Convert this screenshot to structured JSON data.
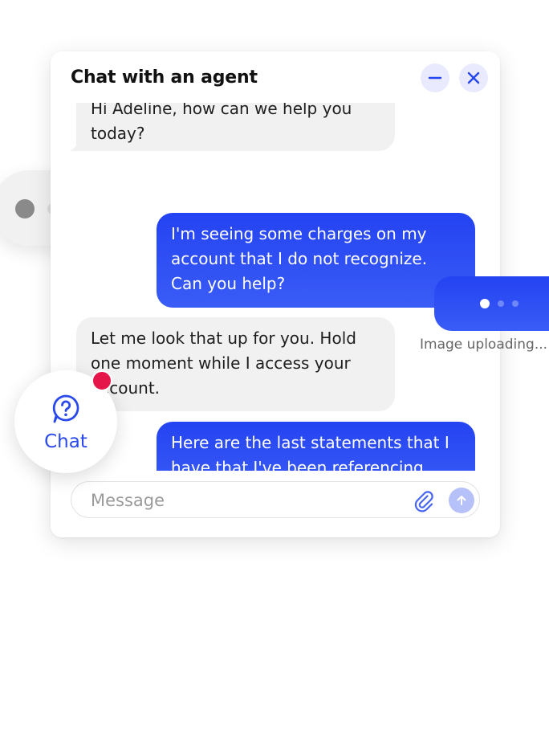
{
  "header": {
    "title": "Chat with an agent"
  },
  "messages": [
    {
      "role": "agent",
      "text": "Hi Adeline, how can we help you today?"
    },
    {
      "role": "user",
      "text": "I'm seeing some charges on my account that I do not recognize. Can you help?"
    },
    {
      "role": "agent",
      "text": "Let me look that up for you. Hold one moment while I access your account."
    },
    {
      "role": "user",
      "text": "Here are the last statements that I have that I've been referencing."
    }
  ],
  "composer": {
    "placeholder": "Message"
  },
  "upload": {
    "status": "Image uploading..."
  },
  "launcher": {
    "label": "Chat"
  },
  "colors": {
    "accent": "#2446f0",
    "agent_bubble": "#f1f1f1",
    "badge": "#e5164a",
    "header_button_bg": "#e9eafe"
  },
  "icons": {
    "minimize": "minimize-icon",
    "close": "close-icon",
    "attach": "paperclip-icon",
    "send": "arrow-up-icon",
    "launcher": "question-chat-icon"
  }
}
